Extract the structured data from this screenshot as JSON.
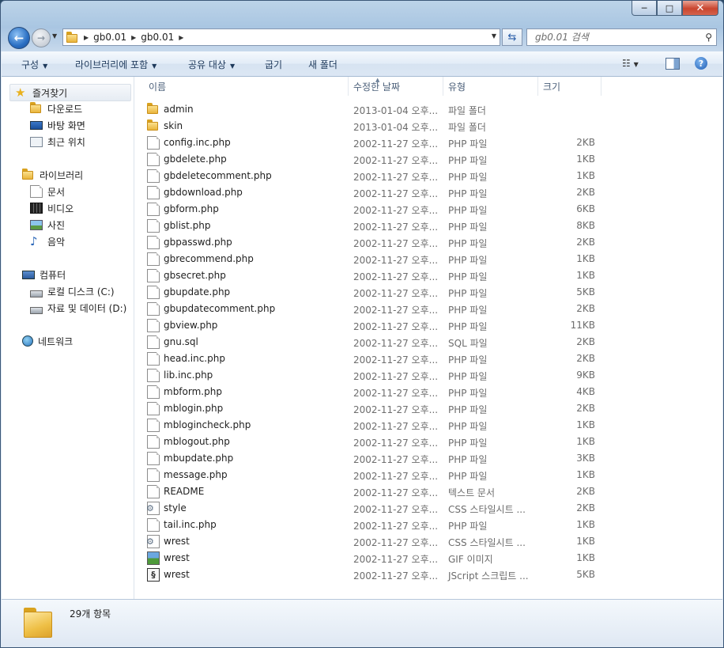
{
  "window": {
    "caption_buttons": [
      "─",
      "□",
      "✕"
    ]
  },
  "address": {
    "crumbs": [
      "gb0.01",
      "gb0.01"
    ]
  },
  "search": {
    "placeholder": "gb0.01 검색"
  },
  "toolbar": {
    "organize": "구성",
    "include_library": "라이브러리에 포함",
    "share_with": "공유 대상",
    "burn": "굽기",
    "new_folder": "새 폴더",
    "help": "?"
  },
  "navpane": {
    "favorites": {
      "label": "즐겨찾기",
      "items": [
        "다운로드",
        "바탕 화면",
        "최근 위치"
      ]
    },
    "libraries": {
      "label": "라이브러리",
      "items": [
        "문서",
        "비디오",
        "사진",
        "음악"
      ]
    },
    "computer": {
      "label": "컴퓨터",
      "items": [
        "로컬 디스크 (C:)",
        "자료 및 데이터 (D:)"
      ]
    },
    "network": {
      "label": "네트워크"
    }
  },
  "columns": {
    "name": "이름",
    "date": "수정한 날짜",
    "type": "유형",
    "size": "크기"
  },
  "files": [
    {
      "name": "admin",
      "date": "2013-01-04 오후...",
      "type": "파일 폴더",
      "size": "",
      "icon": "folder"
    },
    {
      "name": "skin",
      "date": "2013-01-04 오후...",
      "type": "파일 폴더",
      "size": "",
      "icon": "folder"
    },
    {
      "name": "config.inc.php",
      "date": "2002-11-27 오후...",
      "type": "PHP 파일",
      "size": "2KB",
      "icon": "doc"
    },
    {
      "name": "gbdelete.php",
      "date": "2002-11-27 오후...",
      "type": "PHP 파일",
      "size": "1KB",
      "icon": "doc"
    },
    {
      "name": "gbdeletecomment.php",
      "date": "2002-11-27 오후...",
      "type": "PHP 파일",
      "size": "1KB",
      "icon": "doc"
    },
    {
      "name": "gbdownload.php",
      "date": "2002-11-27 오후...",
      "type": "PHP 파일",
      "size": "2KB",
      "icon": "doc"
    },
    {
      "name": "gbform.php",
      "date": "2002-11-27 오후...",
      "type": "PHP 파일",
      "size": "6KB",
      "icon": "doc"
    },
    {
      "name": "gblist.php",
      "date": "2002-11-27 오후...",
      "type": "PHP 파일",
      "size": "8KB",
      "icon": "doc"
    },
    {
      "name": "gbpasswd.php",
      "date": "2002-11-27 오후...",
      "type": "PHP 파일",
      "size": "2KB",
      "icon": "doc"
    },
    {
      "name": "gbrecommend.php",
      "date": "2002-11-27 오후...",
      "type": "PHP 파일",
      "size": "1KB",
      "icon": "doc"
    },
    {
      "name": "gbsecret.php",
      "date": "2002-11-27 오후...",
      "type": "PHP 파일",
      "size": "1KB",
      "icon": "doc"
    },
    {
      "name": "gbupdate.php",
      "date": "2002-11-27 오후...",
      "type": "PHP 파일",
      "size": "5KB",
      "icon": "doc"
    },
    {
      "name": "gbupdatecomment.php",
      "date": "2002-11-27 오후...",
      "type": "PHP 파일",
      "size": "2KB",
      "icon": "doc"
    },
    {
      "name": "gbview.php",
      "date": "2002-11-27 오후...",
      "type": "PHP 파일",
      "size": "11KB",
      "icon": "doc"
    },
    {
      "name": "gnu.sql",
      "date": "2002-11-27 오후...",
      "type": "SQL 파일",
      "size": "2KB",
      "icon": "doc"
    },
    {
      "name": "head.inc.php",
      "date": "2002-11-27 오후...",
      "type": "PHP 파일",
      "size": "2KB",
      "icon": "doc"
    },
    {
      "name": "lib.inc.php",
      "date": "2002-11-27 오후...",
      "type": "PHP 파일",
      "size": "9KB",
      "icon": "doc"
    },
    {
      "name": "mbform.php",
      "date": "2002-11-27 오후...",
      "type": "PHP 파일",
      "size": "4KB",
      "icon": "doc"
    },
    {
      "name": "mblogin.php",
      "date": "2002-11-27 오후...",
      "type": "PHP 파일",
      "size": "2KB",
      "icon": "doc"
    },
    {
      "name": "mblogincheck.php",
      "date": "2002-11-27 오후...",
      "type": "PHP 파일",
      "size": "1KB",
      "icon": "doc"
    },
    {
      "name": "mblogout.php",
      "date": "2002-11-27 오후...",
      "type": "PHP 파일",
      "size": "1KB",
      "icon": "doc"
    },
    {
      "name": "mbupdate.php",
      "date": "2002-11-27 오후...",
      "type": "PHP 파일",
      "size": "3KB",
      "icon": "doc"
    },
    {
      "name": "message.php",
      "date": "2002-11-27 오후...",
      "type": "PHP 파일",
      "size": "1KB",
      "icon": "doc"
    },
    {
      "name": "README",
      "date": "2002-11-27 오후...",
      "type": "텍스트 문서",
      "size": "2KB",
      "icon": "doc"
    },
    {
      "name": "style",
      "date": "2002-11-27 오후...",
      "type": "CSS 스타일시트 ...",
      "size": "2KB",
      "icon": "gear"
    },
    {
      "name": "tail.inc.php",
      "date": "2002-11-27 오후...",
      "type": "PHP 파일",
      "size": "1KB",
      "icon": "doc"
    },
    {
      "name": "wrest",
      "date": "2002-11-27 오후...",
      "type": "CSS 스타일시트 ...",
      "size": "1KB",
      "icon": "gear"
    },
    {
      "name": "wrest",
      "date": "2002-11-27 오후...",
      "type": "GIF 이미지",
      "size": "1KB",
      "icon": "gif"
    },
    {
      "name": "wrest",
      "date": "2002-11-27 오후...",
      "type": "JScript 스크립트 ...",
      "size": "5KB",
      "icon": "js"
    }
  ],
  "status": {
    "count": "29개 항목"
  }
}
